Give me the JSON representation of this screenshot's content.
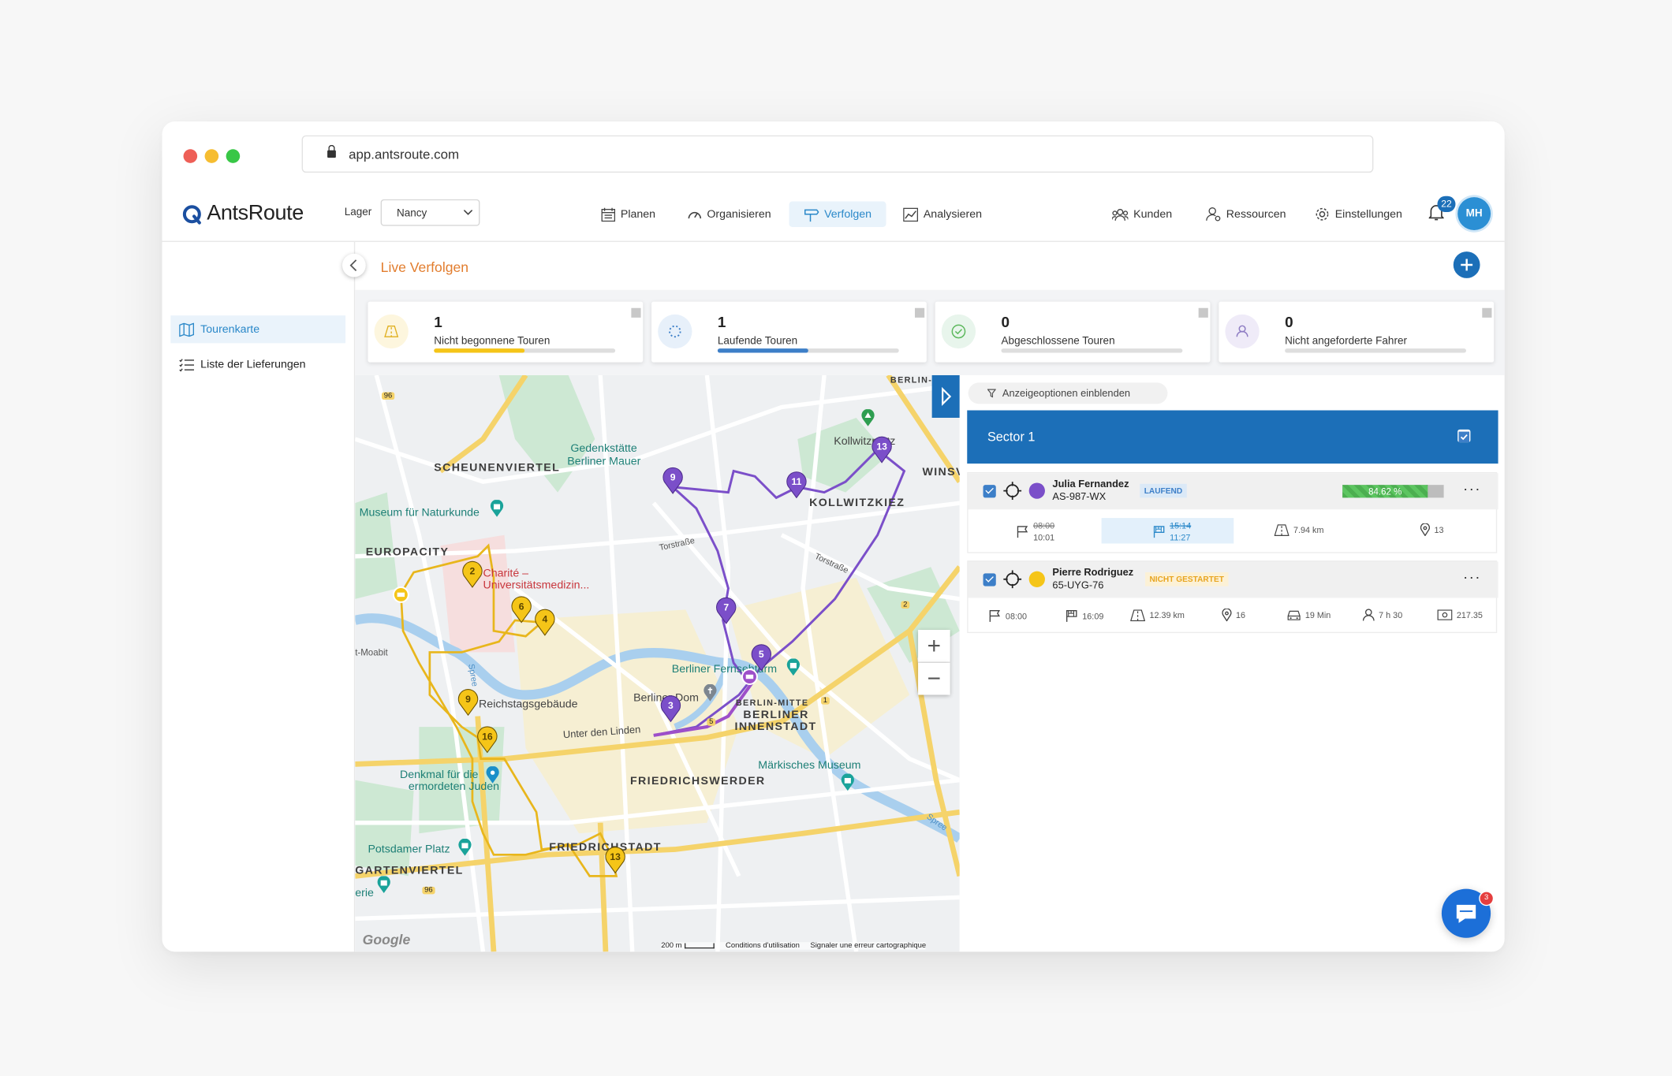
{
  "browser": {
    "url": "app.antsroute.com"
  },
  "app": {
    "logo": "AntsRoute",
    "depot_label": "Lager",
    "depot_value": "Nancy",
    "nav": {
      "plan": "Planen",
      "organize": "Organisieren",
      "track": "Verfolgen",
      "analyze": "Analysieren"
    },
    "right_nav": {
      "customers": "Kunden",
      "resources": "Ressourcen",
      "settings": "Einstellungen"
    },
    "notifications_count": "22",
    "avatar_initials": "MH"
  },
  "sidebar": {
    "items": [
      {
        "label": "Tourenkarte"
      },
      {
        "label": "Liste der Lieferungen"
      }
    ]
  },
  "page": {
    "title": "Live Verfolgen"
  },
  "kpis": [
    {
      "value": "1",
      "label": "Nicht begonnene Touren",
      "progress": 0.5,
      "color": "#f5c518"
    },
    {
      "value": "1",
      "label": "Laufende Touren",
      "progress": 0.5,
      "color": "#3d7fc8"
    },
    {
      "value": "0",
      "label": "Abgeschlossene Touren",
      "progress": 0,
      "color": "#5cb85c"
    },
    {
      "value": "0",
      "label": "Nicht angeforderte Fahrer",
      "progress": 0,
      "color": "#8e7cc3"
    }
  ],
  "map": {
    "labels": {
      "scheunenviertel": "SCHEUNENVIERTEL",
      "europacity": "EUROPACITY",
      "friedrichswerder": "FRIEDRICHSWERDER",
      "friedrichstadt": "FRIEDRICHSTADT",
      "gartenviertel": "GARTENVIERTEL",
      "kollwitzkiez": "KOLLWITZKIEZ",
      "berliner_innenstadt_1": "BERLINER",
      "berliner_innenstadt_2": "INNENSTADT",
      "berlin_mitte": "BERLIN-MITTE",
      "winsv": "WINSV",
      "berlin_p": "BERLIN-P",
      "gedenkstaette_1": "Gedenkstätte",
      "gedenkstaette_2": "Berliner Mauer",
      "museum": "Museum für Naturkunde",
      "charite_1": "Charité –",
      "charite_2": "Universitätsmedizin...",
      "reichstag": "Reichstagsgebäude",
      "denkmal_1": "Denkmal für die",
      "denkmal_2": "ermordeten Juden",
      "potsdamer": "Potsdamer Platz",
      "fernsehturm": "Berliner Fernsehturm",
      "berliner_dom": "Berliner Dom",
      "maerkisches": "Märkisches Museum",
      "kollwitzplatz": "Kollwitzplatz",
      "unter_den_linden": "Unter den Linden",
      "torstrasse_1": "Torstraße",
      "torstrasse_2": "Torstraße",
      "moabit": "t-Moabit",
      "erie": "erie",
      "spree": "Spree",
      "spree_2": "Spree",
      "road_96": "96",
      "road_96b": "96",
      "road_2": "2",
      "road_1": "1",
      "road_5": "5"
    },
    "footer": {
      "scale": "200 m",
      "terms": "Conditions d'utilisation",
      "report": "Signaler une erreur cartographique",
      "google": "Google"
    },
    "purple_stops": [
      "9",
      "11",
      "13",
      "7",
      "5",
      "3"
    ],
    "yellow_stops": [
      "2",
      "6",
      "4",
      "9",
      "16",
      "13"
    ]
  },
  "panel": {
    "display_options": "Anzeigeoptionen einblenden",
    "sector": "Sector 1",
    "tours": [
      {
        "driver": "Julia Fernandez",
        "plate": "AS-987-WX",
        "status": "LAUFEND",
        "progress_text": "84.62 %",
        "progress": 0.8462,
        "color": "#7b4fc9",
        "start_planned": "08:00",
        "start_actual": "10:01",
        "end_planned": "15:14",
        "end_actual": "11:27",
        "distance": "7.94 km",
        "stops": "13"
      },
      {
        "driver": "Pierre Rodriguez",
        "plate": "65-UYG-76",
        "status": "NICHT GESTARTET",
        "color": "#f5c518",
        "start": "08:00",
        "end": "16:09",
        "distance": "12.39 km",
        "stops": "16",
        "drive_time": "19 Min",
        "work_time": "7 h 30",
        "cost": "217.35"
      }
    ]
  },
  "chat": {
    "badge": "3"
  }
}
